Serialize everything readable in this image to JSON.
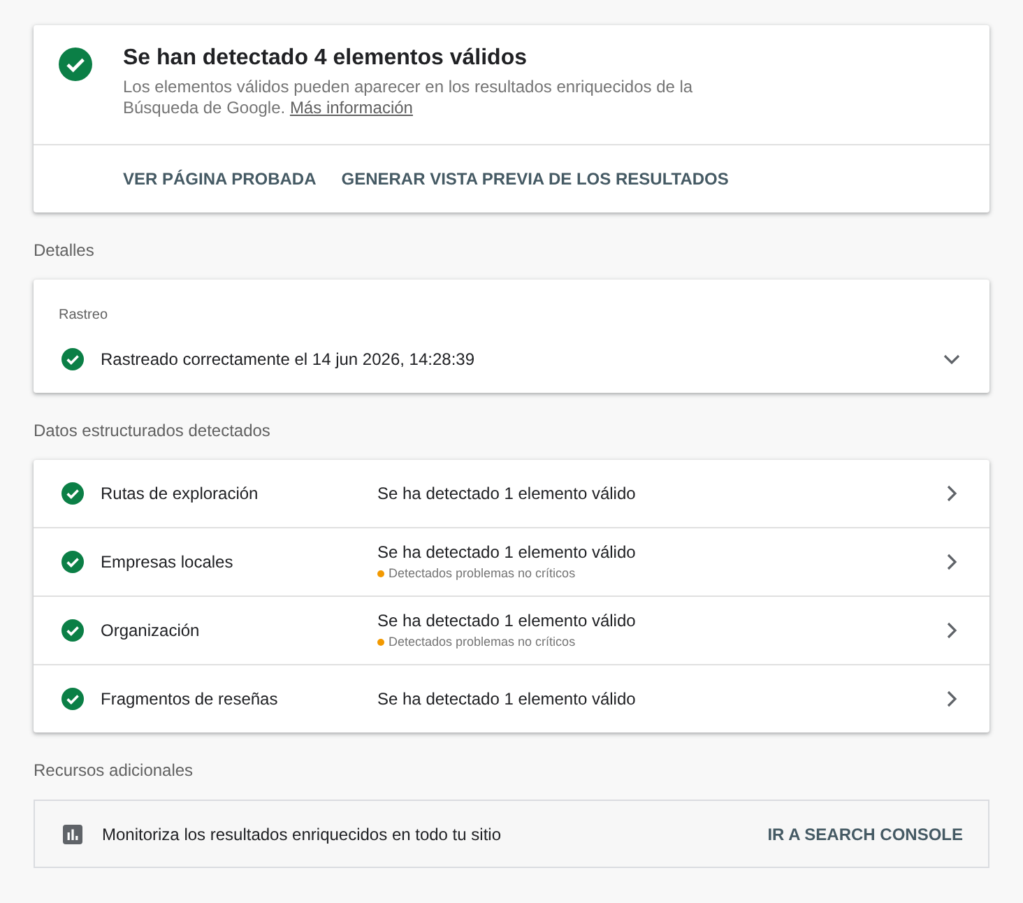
{
  "summary": {
    "title": "Se han detectado 4 elementos válidos",
    "description": "Los elementos válidos pueden aparecer en los resultados enriquecidos de la Búsqueda de Google.",
    "link": "Más información",
    "actions": [
      "VER PÁGINA PROBADA",
      "GENERAR VISTA PREVIA DE LOS RESULTADOS"
    ]
  },
  "details": {
    "heading": "Detalles",
    "crawl": {
      "label": "Rastreo",
      "status": "Rastreado correctamente el 14 jun 2026, 14:28:39",
      "expanded": false
    }
  },
  "structured_data": {
    "heading": "Datos estructurados detectados",
    "items": [
      {
        "name": "Rutas de exploración",
        "result": "Se ha detectado 1 elemento válido"
      },
      {
        "name": "Empresas locales",
        "result": "Se ha detectado 1 elemento válido",
        "note": "Detectados problemas no críticos"
      },
      {
        "name": "Organización",
        "result": "Se ha detectado 1 elemento válido",
        "note": "Detectados problemas no críticos"
      },
      {
        "name": "Fragmentos de reseñas",
        "result": "Se ha detectado 1 elemento válido"
      }
    ]
  },
  "resources": {
    "heading": "Recursos adicionales",
    "text": "Monitoriza los resultados enriquecidos en todo tu sitio",
    "link": "IR A SEARCH CONSOLE"
  }
}
